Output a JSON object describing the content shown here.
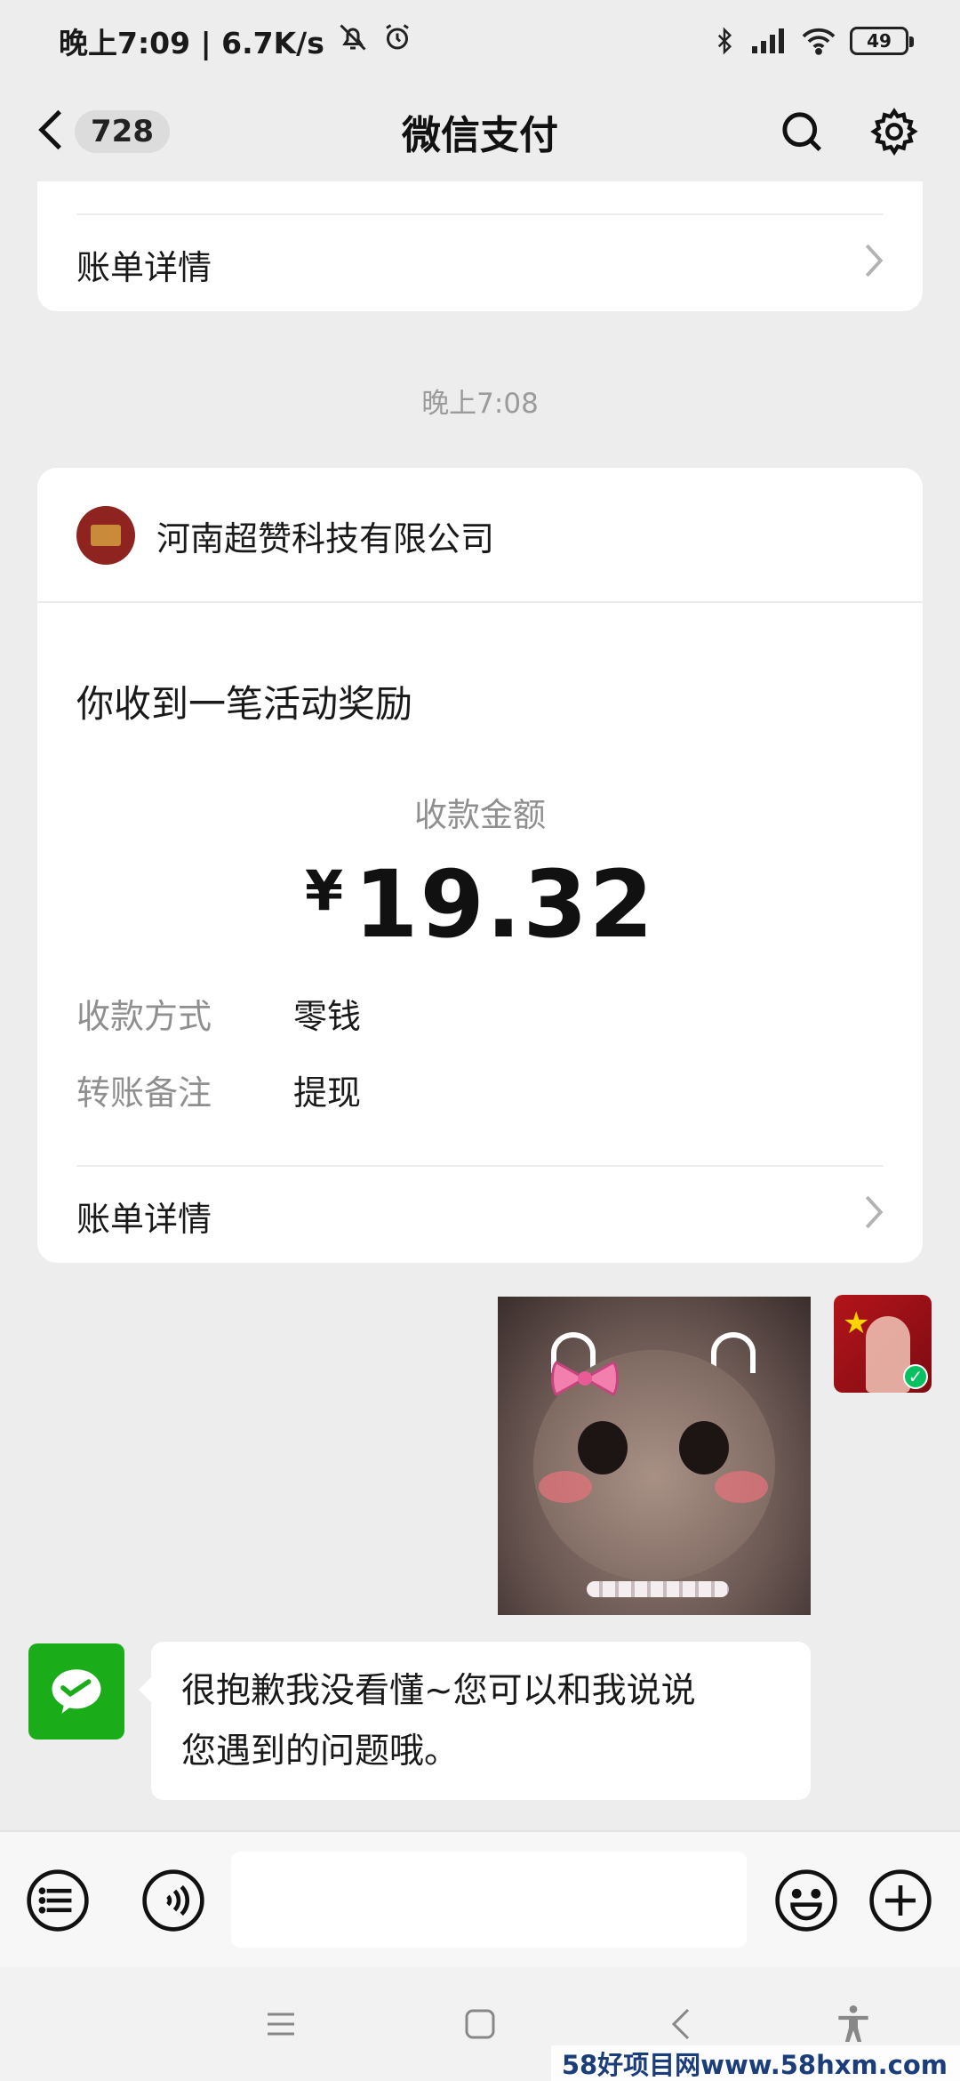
{
  "status_bar": {
    "time_speed": "晚上7:09 | 6.7K/s",
    "battery": "49"
  },
  "nav": {
    "back_count": "728",
    "title": "微信支付"
  },
  "prev_card": {
    "bill_details": "账单详情"
  },
  "timestamp": "晚上7:08",
  "payment_card": {
    "company": "河南超赞科技有限公司",
    "headline": "你收到一笔活动奖励",
    "amount_label": "收款金额",
    "currency": "¥",
    "amount": "19.32",
    "details": [
      {
        "key": "收款方式",
        "value": "零钱"
      },
      {
        "key": "转账备注",
        "value": "提现"
      }
    ],
    "bill_details": "账单详情"
  },
  "reply": {
    "line1": "很抱歉我没看懂~您可以和我说说",
    "line2": "您遇到的问题哦。"
  },
  "watermark": "58好项目网www.58hxm.com",
  "colors": {
    "wechat_green": "#07c160",
    "background": "#ededed"
  }
}
